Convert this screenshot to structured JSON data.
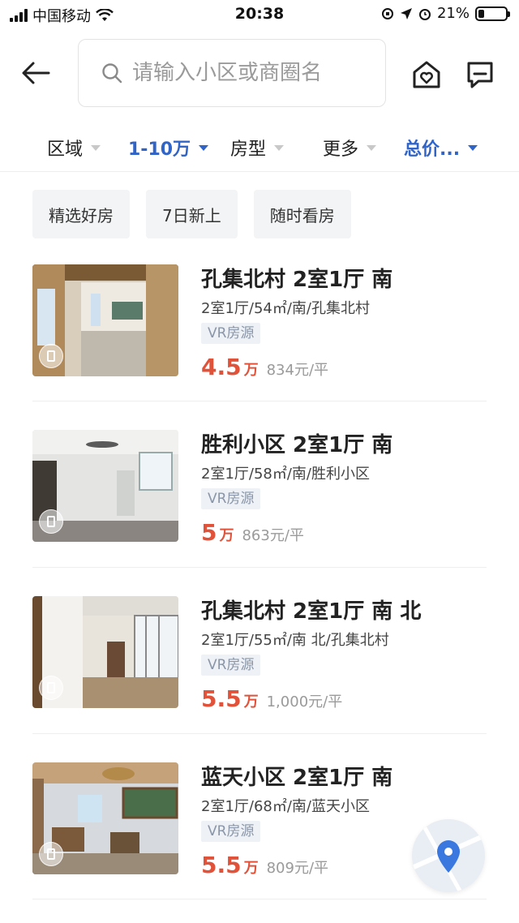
{
  "status_bar": {
    "carrier": "中国移动",
    "time": "20:38",
    "battery_text": "21%",
    "battery_level": 0.21
  },
  "header": {
    "search_placeholder": "请输入小区或商圈名"
  },
  "filters": [
    {
      "label": "区域",
      "active": false
    },
    {
      "label": "1-10万",
      "active": true
    },
    {
      "label": "房型",
      "active": false
    },
    {
      "label": "更多",
      "active": false
    },
    {
      "label": "总价...",
      "active": true
    }
  ],
  "chips": [
    "精选好房",
    "7日新上",
    "随时看房"
  ],
  "listings": [
    {
      "title": "孔集北村 2室1厅 南",
      "desc": "2室1厅/54㎡/南/孔集北村",
      "tag": "VR房源",
      "price": "4.5",
      "price_unit": "万",
      "unit_price": "834元/平"
    },
    {
      "title": "胜利小区 2室1厅 南",
      "desc": "2室1厅/58㎡/南/胜利小区",
      "tag": "VR房源",
      "price": "5",
      "price_unit": "万",
      "unit_price": "863元/平"
    },
    {
      "title": "孔集北村 2室1厅 南 北",
      "desc": "2室1厅/55㎡/南 北/孔集北村",
      "tag": "VR房源",
      "price": "5.5",
      "price_unit": "万",
      "unit_price": "1,000元/平"
    },
    {
      "title": "蓝天小区 2室1厅 南",
      "desc": "2室1厅/68㎡/南/蓝天小区",
      "tag": "VR房源",
      "price": "5.5",
      "price_unit": "万",
      "unit_price": "809元/平"
    }
  ],
  "colors": {
    "accent": "#3164c7",
    "price": "#e0533a",
    "tag_bg": "#eef1f6",
    "fab_pin": "#3a78e0"
  },
  "icons": {
    "back": "arrow-left-icon",
    "search": "search-icon",
    "favorites": "house-heart-icon",
    "messages": "chat-icon",
    "location": "map-pin-icon"
  }
}
